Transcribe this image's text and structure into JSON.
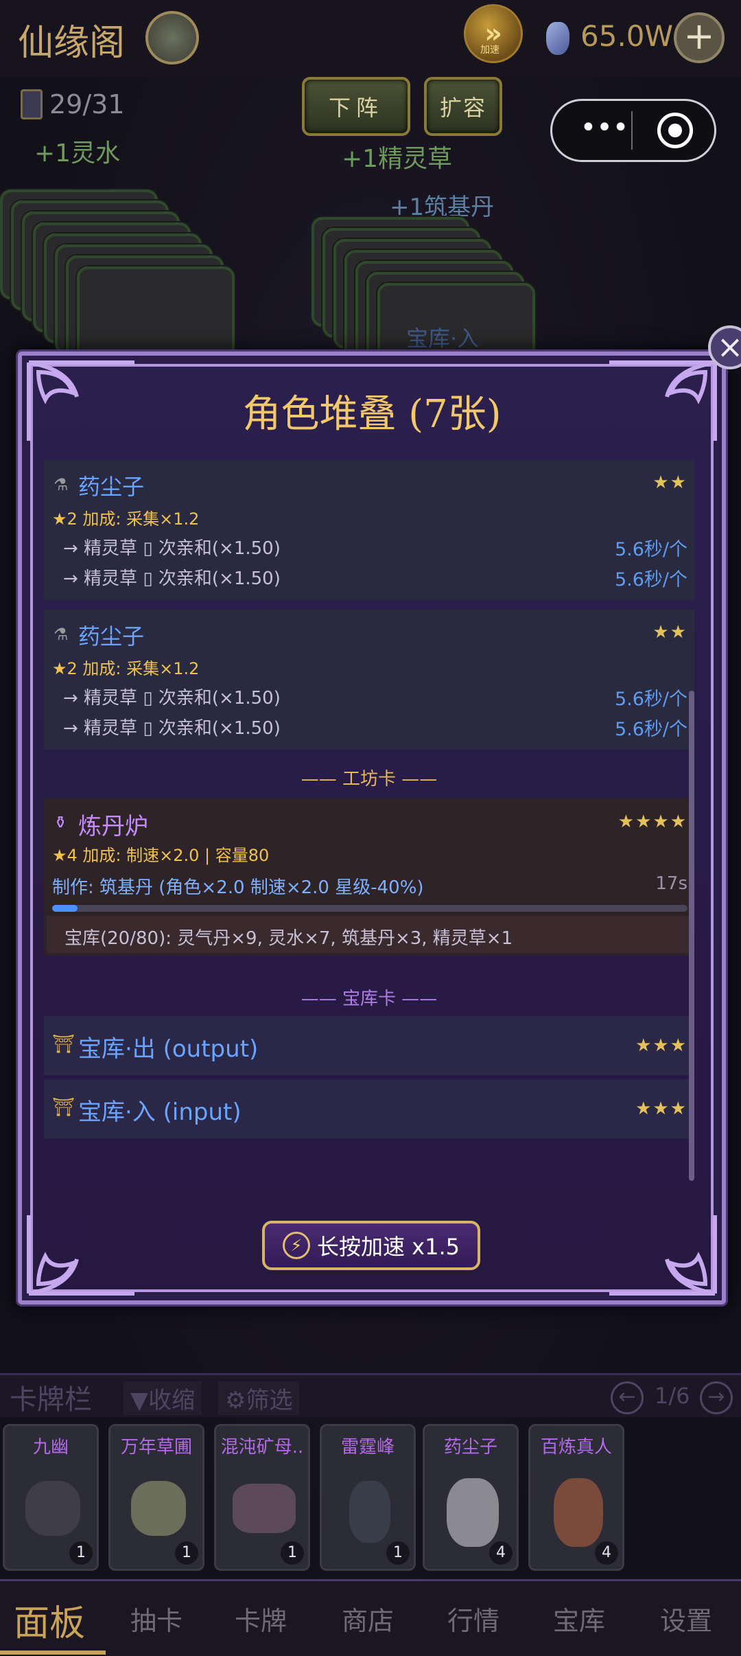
{
  "header": {
    "title": "仙缘阁",
    "currency": "65.0W",
    "speed_label": "加速",
    "card_count": "29/31",
    "deploy": "下阵",
    "expand": "扩容"
  },
  "gains": [
    "+1灵水",
    "+1精灵草",
    "+1筑基丹"
  ],
  "bg_stack_label": "宝库·入",
  "modal": {
    "title": "角色堆叠 (7张)",
    "chars": [
      {
        "name": "药尘子",
        "stars": "★★",
        "bonus": "★2 加成: 采集×1.2",
        "flows": [
          {
            "text": "→ 精灵草 ▯ 次亲和(×1.50)",
            "rate": "5.6秒/个"
          },
          {
            "text": "→ 精灵草 ▯ 次亲和(×1.50)",
            "rate": "5.6秒/个"
          }
        ]
      },
      {
        "name": "药尘子",
        "stars": "★★",
        "bonus": "★2 加成: 采集×1.2",
        "flows": [
          {
            "text": "→ 精灵草 ▯ 次亲和(×1.50)",
            "rate": "5.6秒/个"
          },
          {
            "text": "→ 精灵草 ▯ 次亲和(×1.50)",
            "rate": "5.6秒/个"
          }
        ]
      }
    ],
    "section_workshop": "—— 工坊卡 ——",
    "furnace": {
      "name": "炼丹炉",
      "stars": "★★★★",
      "bonus": "★4 加成: 制速×2.0 | 容量80",
      "craft": "制作: 筑基丹 (角色×2.0 制速×2.0 星级-40%)",
      "time": "17s",
      "progress": 0.04,
      "vault": "宝库(20/80): 灵气丹×9, 灵水×7, 筑基丹×3, 精灵草×1"
    },
    "section_vault": "—— 宝库卡 ——",
    "vaults": [
      {
        "name": "宝库·出 (output)",
        "stars": "★★★"
      },
      {
        "name": "宝库·入 (input)",
        "stars": "★★★"
      }
    ],
    "boost": "长按加速 x1.5"
  },
  "cardbar": {
    "title": "卡牌栏",
    "collapse": "▼收缩",
    "filter": "筛选",
    "page": "1/6"
  },
  "cards": [
    {
      "name": "九幽",
      "count": "1"
    },
    {
      "name": "万年草圃",
      "count": "1"
    },
    {
      "name": "混沌矿母..",
      "count": "1"
    },
    {
      "name": "雷霆峰",
      "count": "1"
    },
    {
      "name": "药尘子",
      "count": "4"
    },
    {
      "name": "百炼真人",
      "count": "4"
    }
  ],
  "nav": [
    "面板",
    "抽卡",
    "卡牌",
    "商店",
    "行情",
    "宝库",
    "设置"
  ],
  "colors": {
    "accent": "#f2c86a",
    "blue": "#6aa4ff",
    "purple": "#c48cff"
  }
}
